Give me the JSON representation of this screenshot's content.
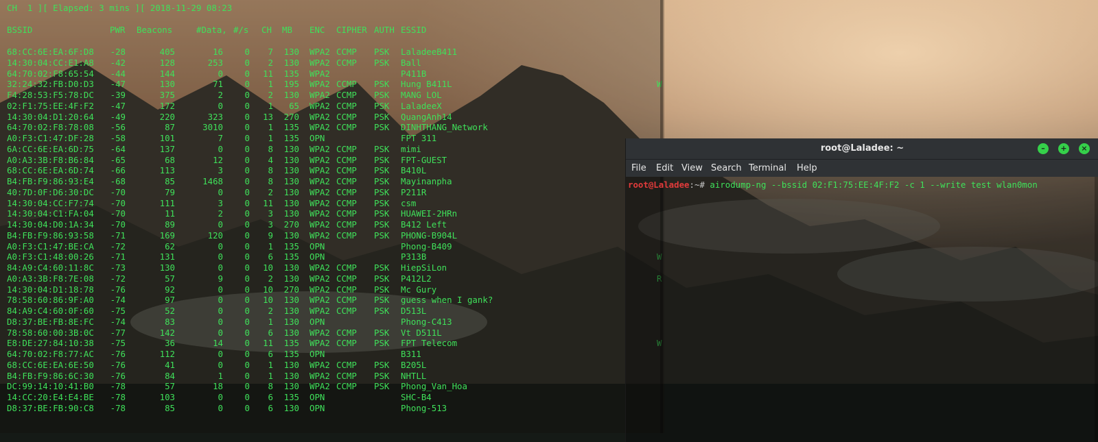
{
  "left_terminal": {
    "status_line": "CH  1 ][ Elapsed: 3 mins ][ 2018-11-29 08:23",
    "headers": [
      "BSSID",
      "PWR",
      "Beacons",
      "#Data,",
      "#/s",
      "CH",
      "MB",
      "ENC",
      "CIPHER",
      "AUTH",
      "ESSID"
    ],
    "rows": [
      [
        "68:CC:6E:EA:6F:D8",
        "-28",
        "405",
        "16",
        "0",
        "7",
        "130",
        "WPA2",
        "CCMP",
        "PSK",
        "LaladeeB411"
      ],
      [
        "14:30:04:CC:E1:A8",
        "-42",
        "128",
        "253",
        "0",
        "2",
        "130",
        "WPA2",
        "CCMP",
        "PSK",
        "Ball"
      ],
      [
        "64:70:02:F8:65:54",
        "-44",
        "144",
        "0",
        "0",
        "11",
        "135",
        "WPA2",
        "",
        "",
        "P411B"
      ],
      [
        "32:24:32:FB:D0:D3",
        "-47",
        "130",
        "71",
        "0",
        "1",
        "195",
        "WPA2",
        "CCMP",
        "PSK",
        "Hung B411L"
      ],
      [
        "F4:28:53:F5:78:DC",
        "-39",
        "375",
        "2",
        "0",
        "2",
        "130",
        "WPA2",
        "CCMP",
        "PSK",
        "MANG LOL"
      ],
      [
        "02:F1:75:EE:4F:F2",
        "-47",
        "172",
        "0",
        "0",
        "1",
        "65",
        "WPA2",
        "CCMP",
        "PSK",
        "LaladeeX"
      ],
      [
        "14:30:04:D1:20:64",
        "-49",
        "220",
        "323",
        "0",
        "13",
        "270",
        "WPA2",
        "CCMP",
        "PSK",
        "QuangAnh14"
      ],
      [
        "64:70:02:F8:78:08",
        "-56",
        "87",
        "3010",
        "0",
        "1",
        "135",
        "WPA2",
        "CCMP",
        "PSK",
        "DINHTHANG_Network"
      ],
      [
        "A0:F3:C1:47:DF:28",
        "-58",
        "101",
        "7",
        "0",
        "1",
        "135",
        "OPN",
        "",
        "",
        "FPT 311"
      ],
      [
        "6A:CC:6E:EA:6D:75",
        "-64",
        "137",
        "0",
        "0",
        "8",
        "130",
        "WPA2",
        "CCMP",
        "PSK",
        "mimi"
      ],
      [
        "A0:A3:3B:F8:B6:84",
        "-65",
        "68",
        "12",
        "0",
        "4",
        "130",
        "WPA2",
        "CCMP",
        "PSK",
        "FPT-GUEST"
      ],
      [
        "68:CC:6E:EA:6D:74",
        "-66",
        "113",
        "3",
        "0",
        "8",
        "130",
        "WPA2",
        "CCMP",
        "PSK",
        "B410L"
      ],
      [
        "B4:FB:F9:86:93:E4",
        "-68",
        "85",
        "1468",
        "0",
        "8",
        "130",
        "WPA2",
        "CCMP",
        "PSK",
        "Mayinanpha"
      ],
      [
        "40:7D:0F:D6:30:DC",
        "-70",
        "79",
        "0",
        "0",
        "2",
        "130",
        "WPA2",
        "CCMP",
        "PSK",
        "P211R"
      ],
      [
        "14:30:04:CC:F7:74",
        "-70",
        "111",
        "3",
        "0",
        "11",
        "130",
        "WPA2",
        "CCMP",
        "PSK",
        "csm"
      ],
      [
        "14:30:04:C1:FA:04",
        "-70",
        "11",
        "2",
        "0",
        "3",
        "130",
        "WPA2",
        "CCMP",
        "PSK",
        "HUAWEI-2HRn"
      ],
      [
        "14:30:04:D0:1A:34",
        "-70",
        "89",
        "0",
        "0",
        "3",
        "270",
        "WPA2",
        "CCMP",
        "PSK",
        "B412 Left"
      ],
      [
        "B4:FB:F9:86:93:58",
        "-71",
        "169",
        "120",
        "0",
        "9",
        "130",
        "WPA2",
        "CCMP",
        "PSK",
        "PHONG-B904L"
      ],
      [
        "A0:F3:C1:47:BE:CA",
        "-72",
        "62",
        "0",
        "0",
        "1",
        "135",
        "OPN",
        "",
        "",
        "Phong-B409"
      ],
      [
        "A0:F3:C1:48:00:26",
        "-71",
        "131",
        "0",
        "0",
        "6",
        "135",
        "OPN",
        "",
        "",
        "P313B"
      ],
      [
        "84:A9:C4:60:11:8C",
        "-73",
        "130",
        "0",
        "0",
        "10",
        "130",
        "WPA2",
        "CCMP",
        "PSK",
        "HiepSiLon"
      ],
      [
        "A0:A3:3B:F8:7E:08",
        "-72",
        "57",
        "9",
        "0",
        "2",
        "130",
        "WPA2",
        "CCMP",
        "PSK",
        "P412L2"
      ],
      [
        "14:30:04:D1:18:78",
        "-76",
        "92",
        "0",
        "0",
        "10",
        "270",
        "WPA2",
        "CCMP",
        "PSK",
        "Mc Gury"
      ],
      [
        "78:58:60:86:9F:A0",
        "-74",
        "97",
        "0",
        "0",
        "10",
        "130",
        "WPA2",
        "CCMP",
        "PSK",
        "guess when I gank?"
      ],
      [
        "84:A9:C4:60:0F:60",
        "-75",
        "52",
        "0",
        "0",
        "2",
        "130",
        "WPA2",
        "CCMP",
        "PSK",
        "D513L"
      ],
      [
        "D8:37:BE:FB:8E:FC",
        "-74",
        "83",
        "0",
        "0",
        "1",
        "130",
        "OPN",
        "",
        "",
        "Phong-C413"
      ],
      [
        "78:58:60:00:3B:0C",
        "-77",
        "142",
        "0",
        "0",
        "6",
        "130",
        "WPA2",
        "CCMP",
        "PSK",
        "Vt D511L"
      ],
      [
        "E8:DE:27:84:10:38",
        "-75",
        "36",
        "14",
        "0",
        "11",
        "135",
        "WPA2",
        "CCMP",
        "PSK",
        "FPT Telecom"
      ],
      [
        "64:70:02:F8:77:AC",
        "-76",
        "112",
        "0",
        "0",
        "6",
        "135",
        "OPN",
        "",
        "",
        "B311"
      ],
      [
        "68:CC:6E:EA:6E:50",
        "-76",
        "41",
        "0",
        "0",
        "1",
        "130",
        "WPA2",
        "CCMP",
        "PSK",
        "B205L"
      ],
      [
        "B4:FB:F9:86:6C:30",
        "-76",
        "84",
        "1",
        "0",
        "1",
        "130",
        "WPA2",
        "CCMP",
        "PSK",
        "NHTLL"
      ],
      [
        "DC:99:14:10:41:B0",
        "-78",
        "57",
        "18",
        "0",
        "8",
        "130",
        "WPA2",
        "CCMP",
        "PSK",
        "Phong_Van_Hoa"
      ],
      [
        "14:CC:20:E4:E4:BE",
        "-78",
        "103",
        "0",
        "0",
        "6",
        "135",
        "OPN",
        "",
        "",
        "SHC-B4"
      ],
      [
        "D8:37:BE:FB:90:C8",
        "-78",
        "85",
        "0",
        "0",
        "6",
        "130",
        "OPN",
        "",
        "",
        "Phong-513"
      ]
    ],
    "side_marks": [
      {
        "row": 3,
        "text": "W"
      },
      {
        "row": 19,
        "text": "W"
      },
      {
        "row": 21,
        "text": "R"
      },
      {
        "row": 27,
        "text": "W"
      }
    ]
  },
  "right_window": {
    "title": "root@Laladee: ~",
    "buttons": {
      "minimize": "–",
      "maximize": "+",
      "close": "×"
    },
    "menu": [
      "File",
      "Edit",
      "View",
      "Search",
      "Terminal",
      "Help"
    ],
    "prompt_user": "root@Laladee",
    "prompt_path": ":~#",
    "command": " airodump-ng --bssid 02:F1:75:EE:4F:F2 -c 1 --write test wlan0mon"
  },
  "colors": {
    "terminal_green": "#3fe15a",
    "prompt_red": "#e23b3b",
    "titlebar": "#2f3235",
    "window_button_green": "#35d04a"
  }
}
